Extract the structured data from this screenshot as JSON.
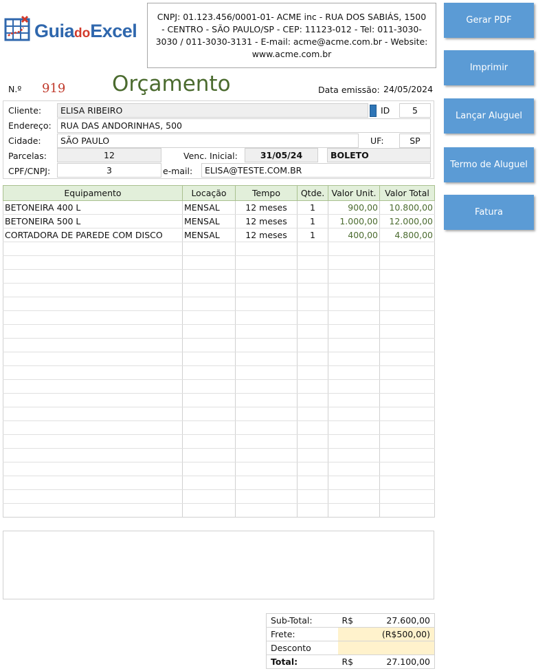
{
  "logo": {
    "part1": "Guia",
    "part2": "do",
    "part3": "Excel"
  },
  "company": {
    "info": "CNPJ: 01.123.456/0001-01- ACME inc - RUA DOS SABIÁS, 1500 - CENTRO - SÃO PAULO/SP - CEP: 11123-012 - Tel: 011-3030-3030 / 011-3030-3131 - E-mail: acme@acme.com.br - Website: www.acme.com.br"
  },
  "buttons": {
    "pdf": "Gerar PDF",
    "print": "Imprimir",
    "rent": "Lançar Aluguel",
    "term": "Termo de Aluguel",
    "invoice": "Fatura"
  },
  "header": {
    "no_label": "N.º",
    "number": "919",
    "title": "Orçamento",
    "date_label": "Data emissão:",
    "date": "24/05/2024"
  },
  "client": {
    "name_label": "Cliente:",
    "name": "ELISA RIBEIRO",
    "id_label": "ID",
    "id": "5",
    "address_label": "Endereço:",
    "address": "RUA DAS ANDORINHAS, 500",
    "city_label": "Cidade:",
    "city": "SÃO PAULO",
    "uf_label": "UF:",
    "uf": "SP",
    "installments_label": "Parcelas:",
    "installments": "12",
    "due_label": "Venc. Inicial:",
    "due": "31/05/24",
    "payment": "BOLETO",
    "doc_label": "CPF/CNPJ:",
    "doc": "3",
    "email_label": "e-mail:",
    "email": "ELISA@TESTE.COM.BR"
  },
  "table": {
    "headers": [
      "Equipamento",
      "Locação",
      "Tempo",
      "Qtde.",
      "Valor Unit.",
      "Valor Total"
    ],
    "rows": [
      [
        "BETONEIRA 400 L",
        "MENSAL",
        "12 meses",
        "1",
        "900,00",
        "10.800,00"
      ],
      [
        "BETONEIRA 500 L",
        "MENSAL",
        "12 meses",
        "1",
        "1.000,00",
        "12.000,00"
      ],
      [
        "CORTADORA DE PAREDE COM DISCO",
        "MENSAL",
        "12 meses",
        "1",
        "400,00",
        "4.800,00"
      ]
    ]
  },
  "totals": {
    "subtotal_label": "Sub-Total:",
    "currency": "R$",
    "subtotal": "27.600,00",
    "freight_label": "Frete:",
    "freight": "(R$500,00)",
    "discount_label": "Desconto",
    "discount": "",
    "total_label": "Total:",
    "total": "27.100,00"
  }
}
